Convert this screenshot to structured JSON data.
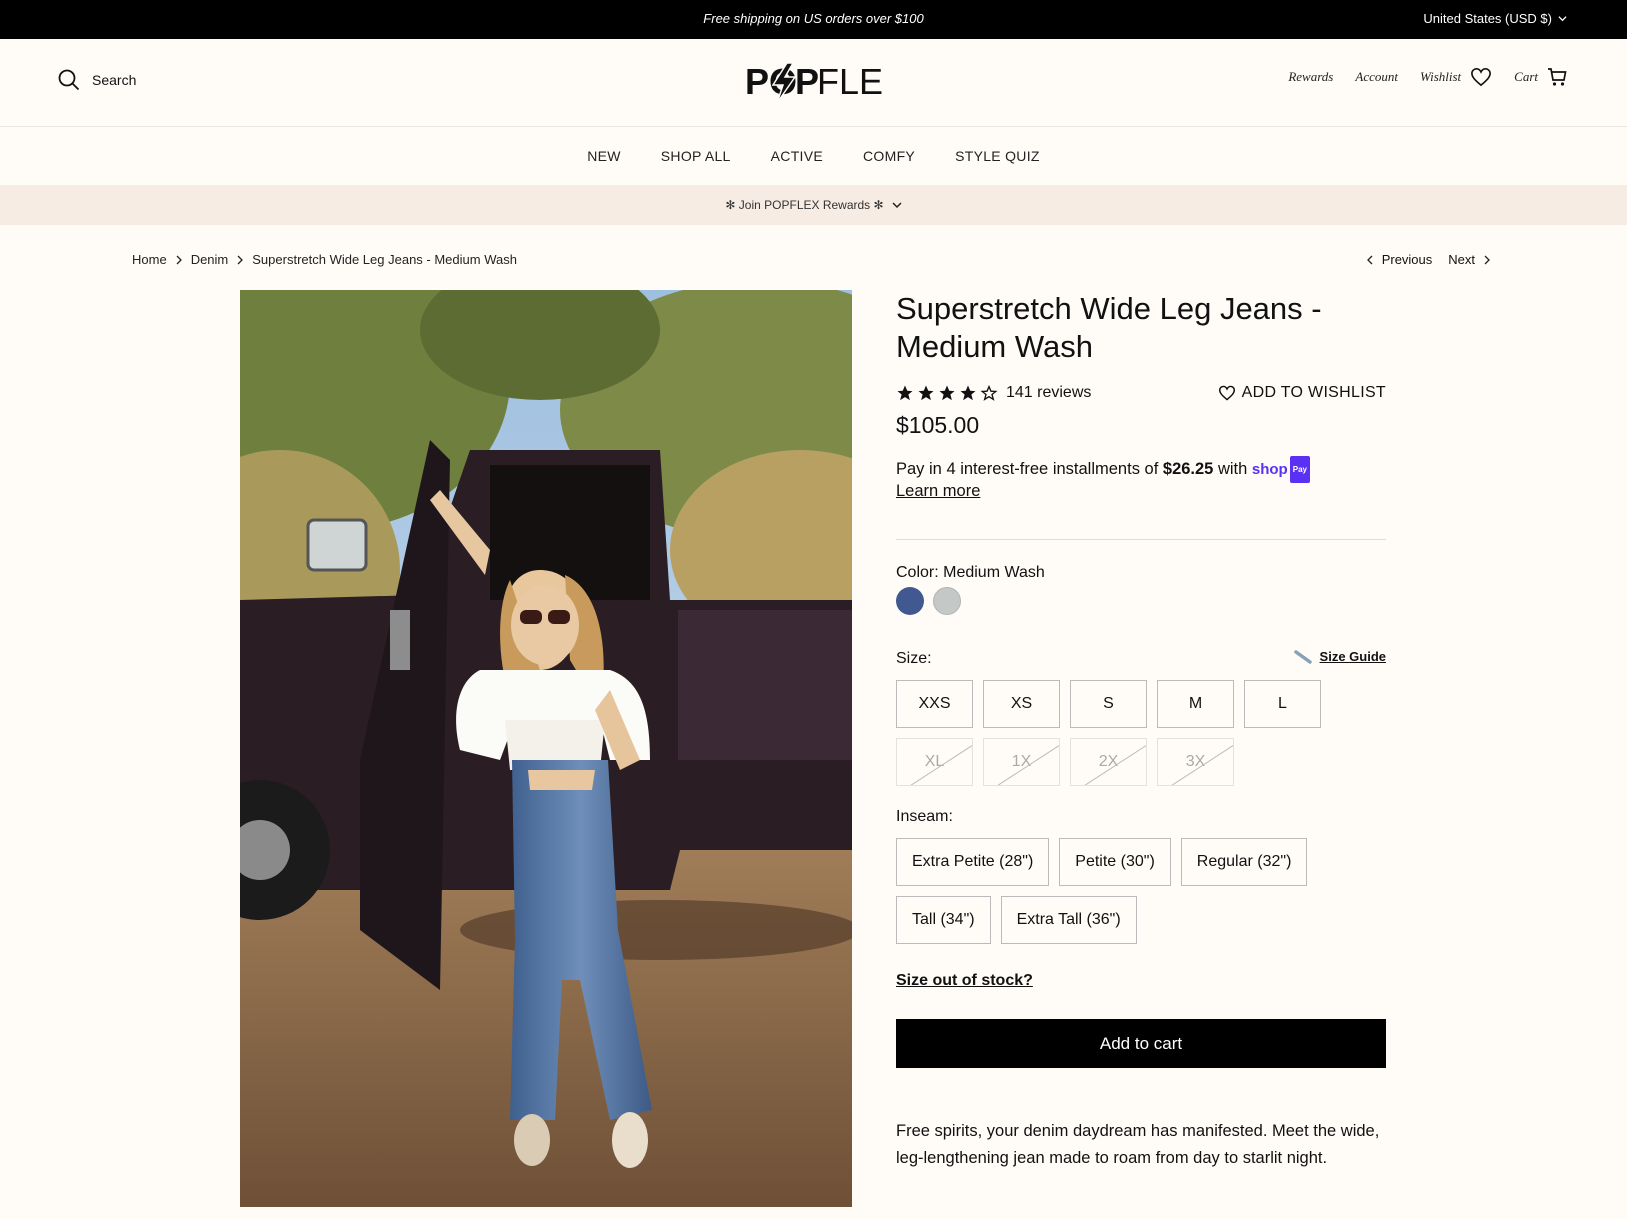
{
  "announcement": {
    "message": "Free shipping on US orders over $100",
    "currency": "United States (USD $)"
  },
  "header": {
    "search_label": "Search",
    "logo_text": "POPFLEX",
    "links": {
      "rewards": "Rewards",
      "account": "Account",
      "wishlist": "Wishlist",
      "cart": "Cart"
    }
  },
  "nav": {
    "items": [
      "NEW",
      "SHOP ALL",
      "ACTIVE",
      "COMFY",
      "STYLE QUIZ"
    ]
  },
  "rewards_bar": {
    "text": "✻ Join POPFLEX Rewards ✻"
  },
  "breadcrumb": {
    "items": [
      "Home",
      "Denim",
      "Superstretch Wide Leg Jeans - Medium Wash"
    ]
  },
  "pager": {
    "previous": "Previous",
    "next": "Next"
  },
  "product": {
    "title": "Superstretch Wide Leg Jeans - Medium Wash",
    "rating": 4,
    "reviews": "141 reviews",
    "wishlist_label": "ADD TO WISHLIST",
    "price": "$105.00",
    "installment": {
      "prefix": "Pay in 4 interest-free installments of",
      "amount": "$26.25",
      "suffix": "with",
      "brand": "shop",
      "brand_badge": "Pay",
      "learn_more": "Learn more"
    },
    "color": {
      "label": "Color: Medium Wash",
      "swatches": [
        {
          "name": "Medium Wash",
          "hex": "#415990",
          "selected": true
        },
        {
          "name": "Light Wash",
          "hex": "#c4c8c6",
          "selected": false
        }
      ]
    },
    "size": {
      "label": "Size:",
      "guide_label": "Size Guide",
      "options": [
        {
          "label": "XXS",
          "available": true
        },
        {
          "label": "XS",
          "available": true
        },
        {
          "label": "S",
          "available": true
        },
        {
          "label": "M",
          "available": true
        },
        {
          "label": "L",
          "available": true
        },
        {
          "label": "XL",
          "available": false
        },
        {
          "label": "1X",
          "available": false
        },
        {
          "label": "2X",
          "available": false
        },
        {
          "label": "3X",
          "available": false
        }
      ]
    },
    "inseam": {
      "label": "Inseam:",
      "options": [
        "Extra Petite (28\")",
        "Petite (30\")",
        "Regular (32\")",
        "Tall (34\")",
        "Extra Tall (36\")"
      ]
    },
    "oos_link": "Size out of stock?",
    "add_to_cart": "Add to cart",
    "description": "Free spirits, your denim daydream has manifested. Meet the wide, leg-lengthening jean made to roam from day to starlit night."
  }
}
